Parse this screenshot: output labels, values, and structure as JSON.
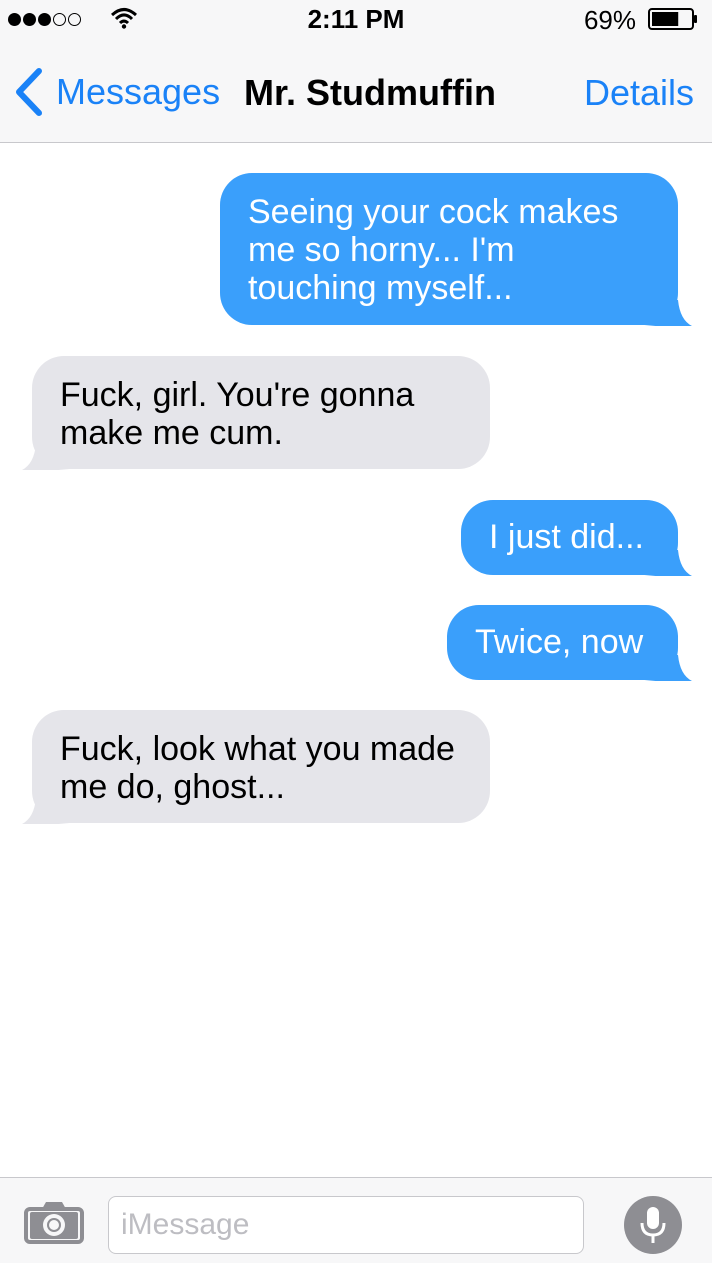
{
  "status_bar": {
    "signal_bars_filled": 3,
    "signal_bars_total": 5,
    "time": "2:11 PM",
    "battery_percent_label": "69%",
    "battery_level": 0.69
  },
  "nav": {
    "back_label": "Messages",
    "title": "Mr. Studmuffin",
    "details_label": "Details"
  },
  "messages": [
    {
      "direction": "outgoing",
      "text": "Seeing your cock makes me so horny... I'm touching myself..."
    },
    {
      "direction": "incoming",
      "text": "Fuck, girl. You're gonna make me cum."
    },
    {
      "direction": "outgoing",
      "text": "I just did..."
    },
    {
      "direction": "outgoing",
      "text": "Twice, now"
    },
    {
      "direction": "incoming",
      "text": "Fuck, look what you made me do, ghost..."
    }
  ],
  "input_bar": {
    "placeholder": "iMessage",
    "value": ""
  },
  "colors": {
    "accent": "#1a82f7",
    "outgoing_bubble": "#3a9ffb",
    "incoming_bubble": "#e5e5ea",
    "bar_background": "#f7f7f8"
  },
  "icons": {
    "back": "chevron-left-icon",
    "wifi": "wifi-icon",
    "battery": "battery-icon",
    "camera": "camera-icon",
    "mic": "microphone-icon"
  }
}
